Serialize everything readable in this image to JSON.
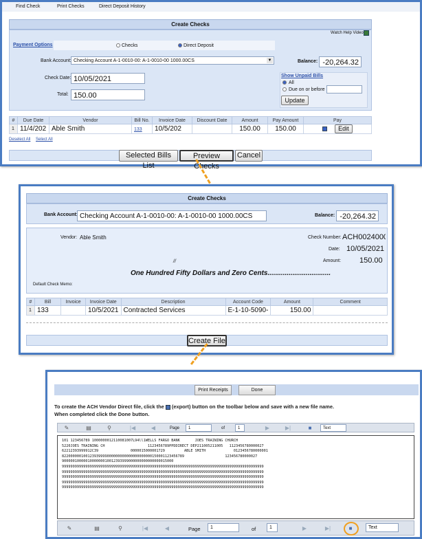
{
  "panel1": {
    "menu": [
      "Find Check",
      "Print Checks",
      "Direct Deposit History"
    ],
    "title": "Create Checks",
    "watch_help": "Watch Help Video!",
    "payment_options_label": "Payment Options",
    "checks_option": "Checks",
    "direct_deposit_option": "Direct Deposit",
    "bank_account_label": "Bank Account:",
    "bank_account_value": "Checking Account A-1-0010-00: A-1-0010-00 1000.00CS",
    "balance_label": "Balance:",
    "balance_value": "-20,264.32",
    "check_date_label": "Check Date:",
    "check_date_value": "10/05/2021",
    "total_label": "Total:",
    "total_value": "150.00",
    "show_unpaid_label": "Show Unpaid Bills",
    "all_option": "All",
    "due_on_before_option": "Due on or before",
    "update_button": "Update",
    "table": {
      "headers": [
        "#",
        "Due Date",
        "Vendor",
        "Bill No.",
        "Invoice Date",
        "Discount Date",
        "Amount",
        "Pay Amount",
        "Pay"
      ],
      "row": {
        "num": "1",
        "due_date": "11/4/202",
        "vendor": "Able Smith",
        "bill_no": "133",
        "invoice_date": "10/5/202",
        "discount_date": "",
        "amount": "150.00",
        "pay_amount": "150.00",
        "edit": "Edit"
      }
    },
    "deselect_all": "Deselect All",
    "select_all": "Select All",
    "selected_bills_button": "Selected Bills List",
    "preview_checks_button": "Preview Checks",
    "cancel_button": "Cancel"
  },
  "panel2": {
    "title": "Create Checks",
    "bank_account_label": "Bank Account:",
    "bank_account_value": "Checking Account A-1-0010-00: A-1-0010-00 1000.00CS",
    "balance_label": "Balance:",
    "balance_value": "-20,264.32",
    "vendor_label": "Vendor:",
    "vendor_value": "Able Smith",
    "check_number_label": "Check Number:",
    "check_number_value": "ACH0024000",
    "date_label": "Date:",
    "date_value": "10/05/2021",
    "amount_label": "Amount:",
    "amount_value": "150.00",
    "slash_mark": "//",
    "amount_words": "One Hundred Fifty Dollars and Zero Cents.................................",
    "memo_label": "Default Check Memo:",
    "table": {
      "headers": [
        "#",
        "Bill",
        "Invoice",
        "Invoice Date",
        "Description",
        "Account Code",
        "Amount",
        "Comment"
      ],
      "row": {
        "num": "1",
        "bill": "133",
        "invoice": "",
        "invoice_date": "10/5/2021",
        "description": "Contracted Services",
        "account_code": "E-1-10-5090-",
        "amount": "150.00",
        "comment": ""
      }
    },
    "create_file_button": "Create File"
  },
  "panel3": {
    "print_receipts_button": "Print Receipts",
    "done_button": "Done",
    "instruction_line1_a": "To create the ACH Vendor Direct file, click the",
    "instruction_line1_b": "(export) button on the toolbar below and save with a new file name.",
    "instruction_line2": "When completed click the Done button.",
    "toolbar": {
      "page_label": "Page",
      "page_value": "1",
      "of_label": "of",
      "of_value": "1",
      "format_value": "Text"
    },
    "ach_lines": [
      "101 123456789 1000000012110081007L94ll1WELLS FARGO BANK       JOES TRAINING CHURCH",
      "5220JOES TRAINING CH                    1123456789PPDDIRECT DEP211005211005   1123456780000027",
      "62212393999912C39               0000015000001729         ABLE SMITH             0123456780000001",
      "822000000100123939999000000000000000000000150001123456789                   123456780000027",
      "9000001000001000000010012393999000000000000000015000",
      "9999999999999999999999999999999999999999999999999999999999999999999999999999999999999999999999",
      "9999999999999999999999999999999999999999999999999999999999999999999999999999999999999999999999",
      "9999999999999999999999999999999999999999999999999999999999999999999999999999999999999999999999",
      "9999999999999999999999999999999999999999999999999999999999999999999999999999999999999999999999",
      "9999999999999999999999999999999999999999999999999999999999999999999999999999999999999999999999"
    ]
  },
  "colors": {
    "accent": "#4a7cc2",
    "highlight": "#f0a020",
    "section_bg": "#dbe6f6"
  }
}
